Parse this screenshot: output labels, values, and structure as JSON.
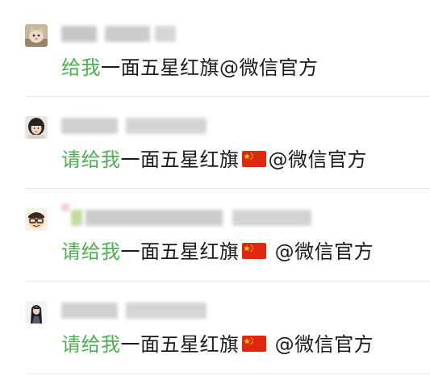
{
  "comments": [
    {
      "avatar_icon": "cat-avatar-icon",
      "keyword": "给我",
      "rest": "一面五星红旗@微信官方",
      "flag": false,
      "trailing": ""
    },
    {
      "avatar_icon": "girl-avatar-icon",
      "keyword": "请给我",
      "rest": "一面五星红旗",
      "flag": true,
      "trailing": "@微信官方"
    },
    {
      "avatar_icon": "cartoon-glasses-avatar-icon",
      "keyword": "请给我",
      "rest": "一面五星红旗",
      "flag": true,
      "trailing": " @微信官方"
    },
    {
      "avatar_icon": "longhair-avatar-icon",
      "keyword": "请给我",
      "rest": "一面五星红旗",
      "flag": true,
      "trailing": " @微信官方"
    }
  ],
  "colors": {
    "keyword": "#4caf50",
    "text": "#1a1a1a",
    "separator": "#e6e6e6",
    "flag_red": "#de2910",
    "flag_star": "#ffde00"
  }
}
